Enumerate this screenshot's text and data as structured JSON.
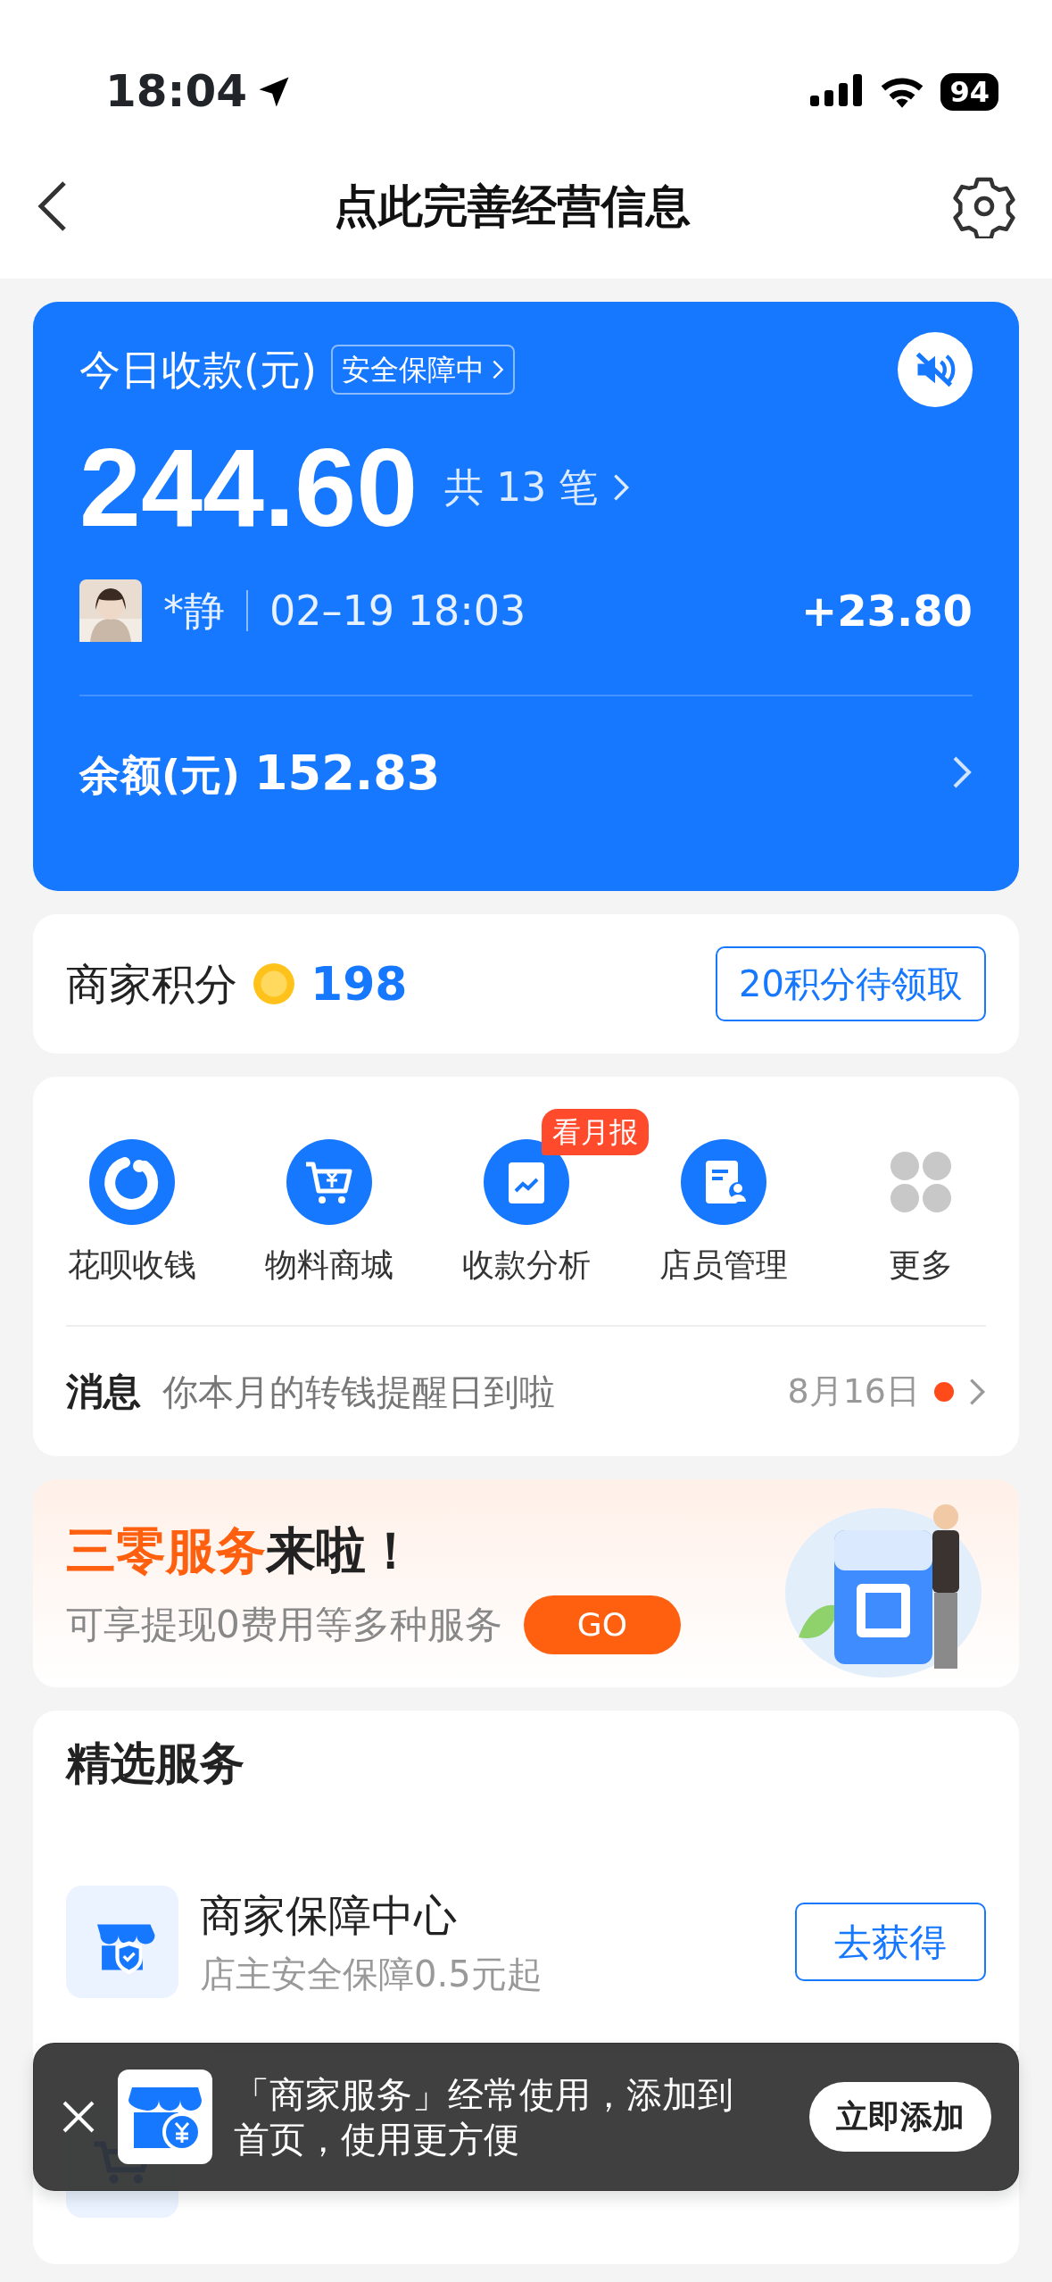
{
  "status_bar": {
    "time": "18:04",
    "battery": "94"
  },
  "header": {
    "title": "点此完善经营信息"
  },
  "receipts": {
    "label": "今日收款(元)",
    "badge": "安全保障中",
    "sound_muted": true,
    "amount": "244.60",
    "count": "共 13 笔",
    "latest": {
      "payer": "*静",
      "time": "02–19 18:03",
      "amount": "+23.80"
    },
    "balance_label": "余额(元)",
    "balance": "152.83"
  },
  "points": {
    "label": "商家积分",
    "value": "198",
    "claim": "20积分待领取"
  },
  "shortcuts": [
    {
      "label": "花呗收钱",
      "kind": "huabei"
    },
    {
      "label": "物料商城",
      "kind": "cart"
    },
    {
      "label": "收款分析",
      "kind": "chart",
      "badge": "看月报"
    },
    {
      "label": "店员管理",
      "kind": "staff"
    },
    {
      "label": "更多",
      "kind": "more"
    }
  ],
  "message": {
    "label": "消息",
    "text": "你本月的转钱提醒日到啦",
    "date": "8月16日",
    "unread": true
  },
  "promo": {
    "highlight": "三零服务",
    "title_rest": "来啦！",
    "subtitle": "可享提现0费用等多种服务",
    "button": "GO"
  },
  "services": {
    "title": "精选服务",
    "items": [
      {
        "kind": "shield",
        "name": "商家保障中心",
        "desc": "店主安全保障0.5元起",
        "action": "去获得"
      },
      {
        "kind": "cart"
      }
    ]
  },
  "toast": {
    "text": "「商家服务」经常使用，添加到首页，使用更方便",
    "button": "立即添加"
  }
}
